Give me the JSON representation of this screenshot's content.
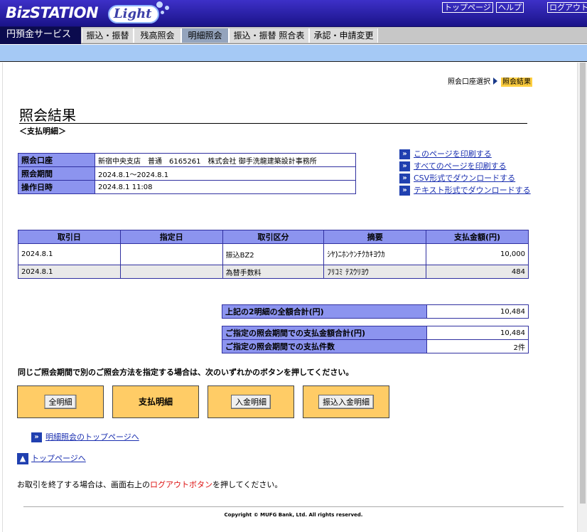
{
  "header": {
    "logo_text": "BizSTATION",
    "logo_light": "Light",
    "buttons": [
      "トップページ",
      "ヘルプ",
      "ログアウト"
    ]
  },
  "service_label": "円預金サービス",
  "tabs": [
    "振込・振替",
    "残高照会",
    "明細照会",
    "振込・振替 照合表",
    "承認・申請変更"
  ],
  "selected_tab": "明細照会",
  "breadcrumb": {
    "step1": "照会口座選択",
    "current": "照会結果"
  },
  "page_title": "照会結果",
  "subtitle": "＜支払明細＞",
  "info": [
    {
      "label": "照会口座",
      "value": "新宿中央支店　普通　6165261　株式会社 御手洗龍建築設計事務所"
    },
    {
      "label": "照会期間",
      "value": "2024.8.1〜2024.8.1"
    },
    {
      "label": "操作日時",
      "value": "2024.8.1 11:08"
    }
  ],
  "print_links": [
    "このページを印刷する",
    "すべてのページを印刷する",
    "CSV形式でダウンロードする",
    "テキスト形式でダウンロードする"
  ],
  "details": {
    "headers": [
      "取引日",
      "指定日",
      "取引区分",
      "摘要",
      "支払金額(円)"
    ],
    "rows": [
      [
        "2024.8.1",
        "",
        "振込BZ2",
        "ｼﾔ)ﾆﾎﾝｹﾝﾁｸｶｷﾖｳｶ",
        "10,000"
      ],
      [
        "2024.8.1",
        "",
        "為替手数料",
        "ﾌﾘｺﾐ ﾃｽｳﾘﾖｳ",
        "484"
      ]
    ]
  },
  "totals": {
    "line_total_label": "上記の2明細の全額合計(円)",
    "line_total_value": "10,484",
    "period_total_label": "ご指定の照会期間での支払金額合計(円)",
    "period_total_value": "10,484",
    "period_count_label": "ご指定の照会期間での支払件数",
    "period_count_value": "2件"
  },
  "instruction": "同じご照会期間で別のご照会方法を指定する場合は、次のいずれかのボタンを押してください。",
  "method_buttons": [
    "全明細",
    "支払明細",
    "入金明細",
    "振込入金明細"
  ],
  "nav_link": "明細照会のトップページへ",
  "top_link": "トップページへ",
  "end_message": {
    "before": "お取引を終了する場合は、画面右上の",
    "highlight": "ログアウトボタン",
    "after": "を押してください。"
  },
  "copyright": "Copyright © MUFG Bank, Ltd. All rights reserved.",
  "colors": {
    "header_blue": "#2a20b0",
    "table_header": "#8c94ef",
    "orange_box": "#ffcc66",
    "breadcrumb_current": "#ffcf40"
  }
}
